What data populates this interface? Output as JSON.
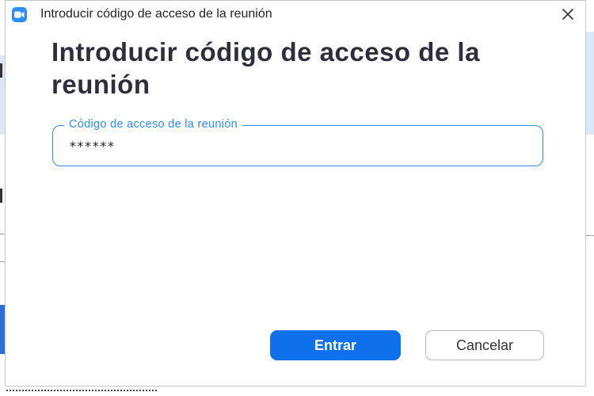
{
  "window": {
    "title": "Introducir código de acceso de la reunión",
    "app_icon": "zoom-camera-icon",
    "close_icon": "close-icon"
  },
  "dialog": {
    "heading": "Introducir código de acceso de la reunión",
    "passcode_field": {
      "label": "Código de acceso de la reunión",
      "value": "******"
    },
    "buttons": {
      "join_label": "Entrar",
      "cancel_label": "Cancelar"
    }
  },
  "colors": {
    "accent": "#2d8cff",
    "primary_button": "#0e71eb",
    "heading_text": "#2e2e3c"
  }
}
